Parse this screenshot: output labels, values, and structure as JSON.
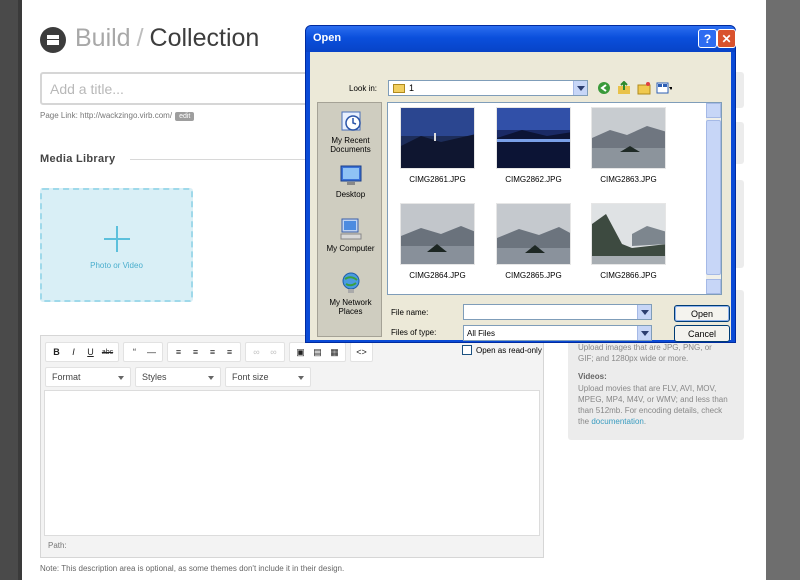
{
  "header": {
    "breadcrumb_root": "Build",
    "breadcrumb_sep": "/",
    "breadcrumb_current": "Collection"
  },
  "title_field": {
    "placeholder": "Add a title..."
  },
  "page_link": {
    "text": "Page Link: http://wackzingo.virb.com/",
    "edit_label": "edit"
  },
  "media": {
    "heading": "Media Library",
    "dropzone_label": "Photo or Video"
  },
  "editor": {
    "toolbar_row1": [
      "B",
      "I",
      "U",
      "abc",
      "“",
      "—",
      "≡",
      "≡",
      "≡",
      "≡",
      "∞",
      "∞",
      "▣",
      "▤",
      "▦",
      "<>"
    ],
    "format_label": "Format",
    "styles_label": "Styles",
    "fontsize_label": "Font size",
    "path_label": "Path:"
  },
  "note": "Note: This description area is optional, as some themes don't include it in their design.",
  "sidebar_info": {
    "images_text": "Upload images that are JPG, PNG, or GIF; and 1280px wide or more.",
    "videos_heading": "Videos:",
    "videos_text": "Upload movies that are FLV, AVI, MOV, MPEG, MP4, M4V, or WMV; and less than than 512mb. For encoding details, check the",
    "videos_link": "documentation",
    "videos_end": "."
  },
  "dialog": {
    "title": "Open",
    "help_label": "?",
    "close_label": "✕",
    "look_in_label": "Look in:",
    "look_in_value": "1",
    "places": [
      "My Recent Documents",
      "Desktop",
      "My Computer",
      "My Network Places"
    ],
    "files": [
      "CIMG2861.JPG",
      "CIMG2862.JPG",
      "CIMG2863.JPG",
      "CIMG2864.JPG",
      "CIMG2865.JPG",
      "CIMG2866.JPG"
    ],
    "file_name_label": "File name:",
    "file_name_value": "",
    "files_of_type_label": "Files of type:",
    "files_of_type_value": "All Files",
    "open_label": "Open",
    "cancel_label": "Cancel",
    "read_only_label": "Open as read-only"
  }
}
